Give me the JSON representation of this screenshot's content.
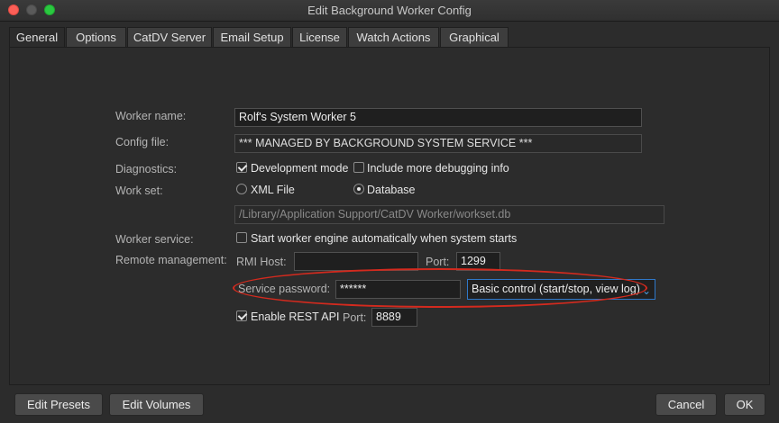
{
  "window": {
    "title": "Edit Background Worker Config"
  },
  "tabs": [
    {
      "label": "General",
      "active": true
    },
    {
      "label": "Options",
      "active": false
    },
    {
      "label": "CatDV Server",
      "active": false
    },
    {
      "label": "Email Setup",
      "active": false
    },
    {
      "label": "License",
      "active": false
    },
    {
      "label": "Watch Actions",
      "active": false
    },
    {
      "label": "Graphical",
      "active": false
    }
  ],
  "form": {
    "worker_name_label": "Worker name:",
    "worker_name_value": "Rolf's System Worker 5",
    "config_file_label": "Config file:",
    "config_file_value": "*** MANAGED BY BACKGROUND SYSTEM SERVICE ***",
    "diagnostics_label": "Diagnostics:",
    "dev_mode_label": "Development mode",
    "dev_mode_checked": true,
    "debug_info_label": "Include more debugging info",
    "debug_info_checked": false,
    "work_set_label": "Work set:",
    "xml_file_label": "XML File",
    "database_label": "Database",
    "work_set_selected": "Database",
    "workset_path": "/Library/Application Support/CatDV Worker/workset.db",
    "worker_service_label": "Worker service:",
    "auto_start_label": "Start worker engine automatically when system starts",
    "auto_start_checked": false,
    "remote_mgmt_label": "Remote management:",
    "rmi_host_label": "RMI Host:",
    "rmi_host_value": "",
    "rmi_port_label": "Port:",
    "rmi_port_value": "1299",
    "service_password_label": "Service password:",
    "service_password_value": "******",
    "control_select_value": "Basic control (start/stop, view log)",
    "rest_api_label": "Enable REST API",
    "rest_api_checked": true,
    "rest_port_label": "Port:",
    "rest_port_value": "8889"
  },
  "buttons": {
    "edit_presets": "Edit Presets",
    "edit_volumes": "Edit Volumes",
    "cancel": "Cancel",
    "ok": "OK"
  },
  "colors": {
    "highlight_oval": "#d42a1e",
    "select_border": "#2f78c9",
    "close_button": "#fc5f57",
    "maximize_button": "#2ac840"
  }
}
